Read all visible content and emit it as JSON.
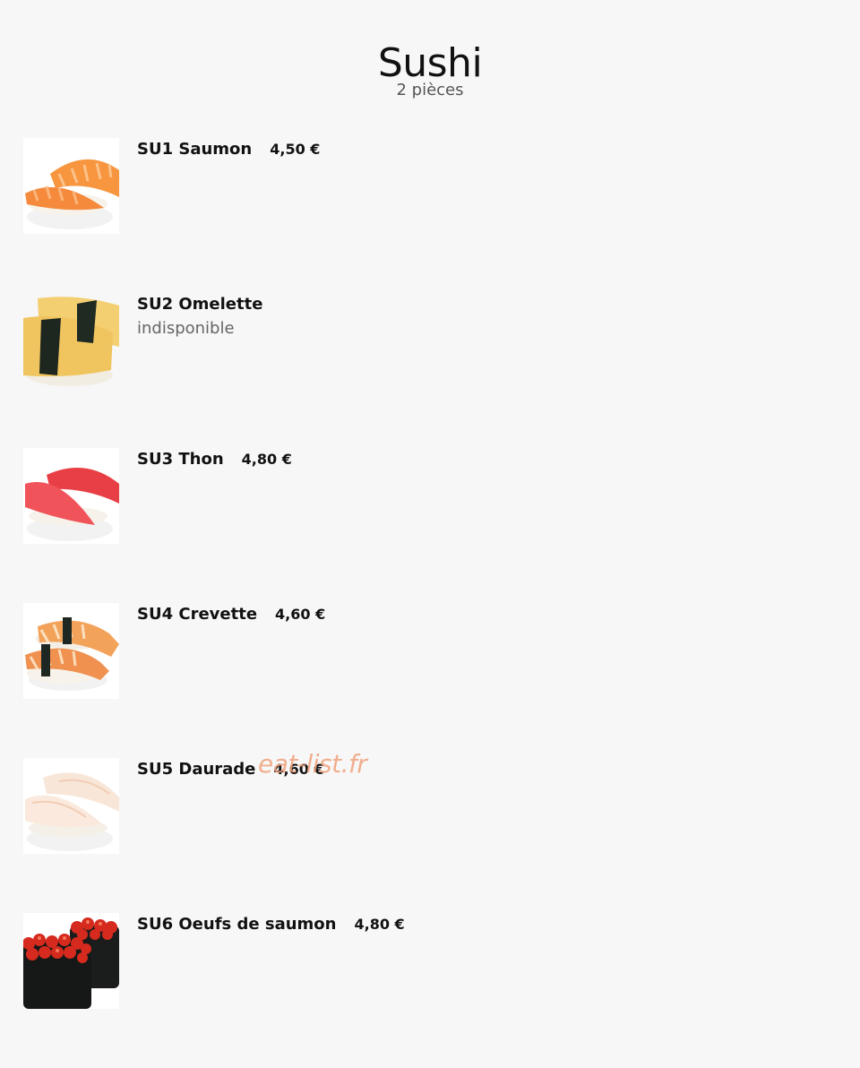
{
  "header": {
    "title": "Sushi",
    "subtitle": "2 pièces"
  },
  "items": [
    {
      "name": "SU1 Saumon",
      "price": "4,50 €",
      "status": "",
      "icon": "salmon-nigiri"
    },
    {
      "name": "SU2 Omelette",
      "price": "",
      "status": "indisponible",
      "icon": "omelette-nigiri"
    },
    {
      "name": "SU3 Thon",
      "price": "4,80 €",
      "status": "",
      "icon": "tuna-nigiri"
    },
    {
      "name": "SU4 Crevette",
      "price": "4,60 €",
      "status": "",
      "icon": "shrimp-nigiri"
    },
    {
      "name": "SU5 Daurade",
      "price": "4,60 €",
      "status": "",
      "icon": "sea-bream-nigiri"
    },
    {
      "name": "SU6 Oeufs de saumon",
      "price": "4,80 €",
      "status": "",
      "icon": "salmon-roe-gunkan"
    }
  ],
  "watermark": "eat-list.fr",
  "colors": {
    "background": "#f7f7f7",
    "text": "#111111",
    "muted": "#666666",
    "watermark": "#f0a27c"
  }
}
